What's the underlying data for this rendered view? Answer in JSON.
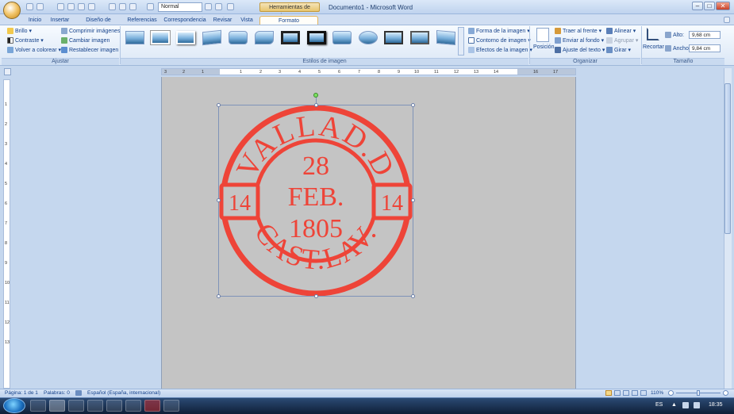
{
  "titlebar": {
    "style_box": "Normal",
    "contextual_tab": "Herramientas de imagen",
    "document_title": "Documento1 - Microsoft Word"
  },
  "tabs": [
    "Inicio",
    "Insertar",
    "Diseño de página",
    "Referencias",
    "Correspondencia",
    "Revisar",
    "Vista",
    "Formato"
  ],
  "ribbon": {
    "ajustar": {
      "brillo": "Brillo",
      "contraste": "Contraste",
      "volver_colorear": "Volver a colorear",
      "comprimir": "Comprimir imágenes",
      "cambiar": "Cambiar imagen",
      "restablecer": "Restablecer imagen",
      "group_label": "Ajustar"
    },
    "estilos": {
      "group_label": "Estilos de imagen",
      "forma": "Forma de la imagen",
      "contorno": "Contorno de imagen",
      "efectos": "Efectos de la imagen"
    },
    "organizar": {
      "posicion": "Posición",
      "traer": "Traer al frente",
      "enviar": "Enviar al fondo",
      "ajuste": "Ajuste del texto",
      "alinear": "Alinear",
      "agrupar": "Agrupar",
      "girar": "Girar",
      "group_label": "Organizar"
    },
    "tamano": {
      "recortar": "Recortar",
      "alto_label": "Alto:",
      "alto_value": "9,68 cm",
      "ancho_label": "Ancho:",
      "ancho_value": "9,84 cm",
      "group_label": "Tamaño"
    }
  },
  "ruler": {
    "h_ticks": [
      "3",
      "2",
      "1",
      "1",
      "2",
      "3",
      "4",
      "5",
      "6",
      "7",
      "8",
      "9",
      "10",
      "11",
      "12",
      "13",
      "14",
      "16",
      "17"
    ],
    "v_ticks": [
      "1",
      "2",
      "3",
      "4",
      "5",
      "6",
      "7",
      "8",
      "9",
      "10",
      "11",
      "12",
      "13"
    ]
  },
  "stamp": {
    "top_arc": "VALLAD.D",
    "day": "28",
    "month": "FEB.",
    "year": "1805",
    "left_num": "14",
    "right_num": "14",
    "bottom_arc": "CAST.LAV.",
    "ink_color": "#ee4438"
  },
  "statusbar": {
    "pagina": "Página: 1 de 1",
    "palabras": "Palabras: 0",
    "idioma": "Español (España, internacional)",
    "zoom": "110%"
  },
  "taskbar": {
    "lang": "ES",
    "time": "18:35"
  }
}
